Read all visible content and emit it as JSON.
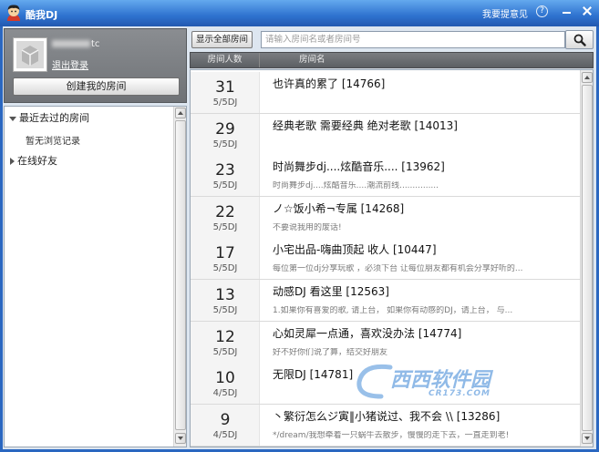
{
  "window": {
    "title": "酷我DJ",
    "feedback": "我要提意见",
    "help_label": "?"
  },
  "user": {
    "name": "tc",
    "logout": "退出登录",
    "create_room": "创建我的房间"
  },
  "tree": {
    "recent": {
      "label": "最近去过的房间",
      "expanded": true,
      "empty": "暂无浏览记录"
    },
    "friends": {
      "label": "在线好友",
      "expanded": false
    }
  },
  "toolbar": {
    "show_all": "显示全部房间",
    "search_placeholder": "请输入房间名或者房间号"
  },
  "columns": {
    "count": "房间人数",
    "name": "房间名"
  },
  "rooms": [
    {
      "count": 31,
      "dj": "5/5DJ",
      "title": "也许真的累了 [14766]"
    },
    {
      "count": 29,
      "dj": "5/5DJ",
      "title": "经典老歌 需要经典  绝对老歌 [14013]"
    },
    {
      "count": 23,
      "dj": "5/5DJ",
      "title": "时尚舞步dj....炫酷音乐.... [13962]",
      "desc": "时尚舞步dj....炫酷音乐....潮流前线..............."
    },
    {
      "count": 22,
      "dj": "5/5DJ",
      "title": "ノ☆饭小希¬专属 [14268]",
      "desc": "不要说我用的废话!"
    },
    {
      "count": 17,
      "dj": "5/5DJ",
      "title": "小宅出品-嗨曲顶起 收人 [10447]",
      "desc": "每位第一位dj分享玩歌 ，必须下台 让每位朋友都有机会分享好听的..."
    },
    {
      "count": 13,
      "dj": "5/5DJ",
      "title": "动感DJ 看这里 [12563]",
      "desc": "1.如果你有喜爱的歌, 请上台， 如果你有动感的DJ，请上台， 与..."
    },
    {
      "count": 12,
      "dj": "5/5DJ",
      "title": "心如灵犀一点通，喜欢没办法 [14774]",
      "desc": "好不好你们说了算，结交好朋友"
    },
    {
      "count": 10,
      "dj": "4/5DJ",
      "title": "无限DJ [14781]"
    },
    {
      "count": 9,
      "dj": "4/5DJ",
      "title": "丶繁衍怎么ジ寅‖小猪说过、我不会 \\\\ [13286]",
      "desc": "*/dream/我想牵着一只蜗牛去散步，慢慢的走下去，一直走到老!"
    }
  ],
  "watermark": {
    "brand": "西西软件园",
    "site": "CR173.COM"
  },
  "icons": {
    "app": "app-logo-icon",
    "help": "help-icon",
    "minimize": "minimize-icon",
    "close": "close-icon",
    "avatar": "default-avatar-icon",
    "search": "search-icon",
    "expand": "chevron-down-icon",
    "collapse": "chevron-right-icon"
  },
  "colors": {
    "titlebar": "#2e72cf",
    "frame": "#2a67c0",
    "header": "#5c5f63",
    "user_panel": "#6f7276",
    "panel_bg": "#dde6f0"
  }
}
